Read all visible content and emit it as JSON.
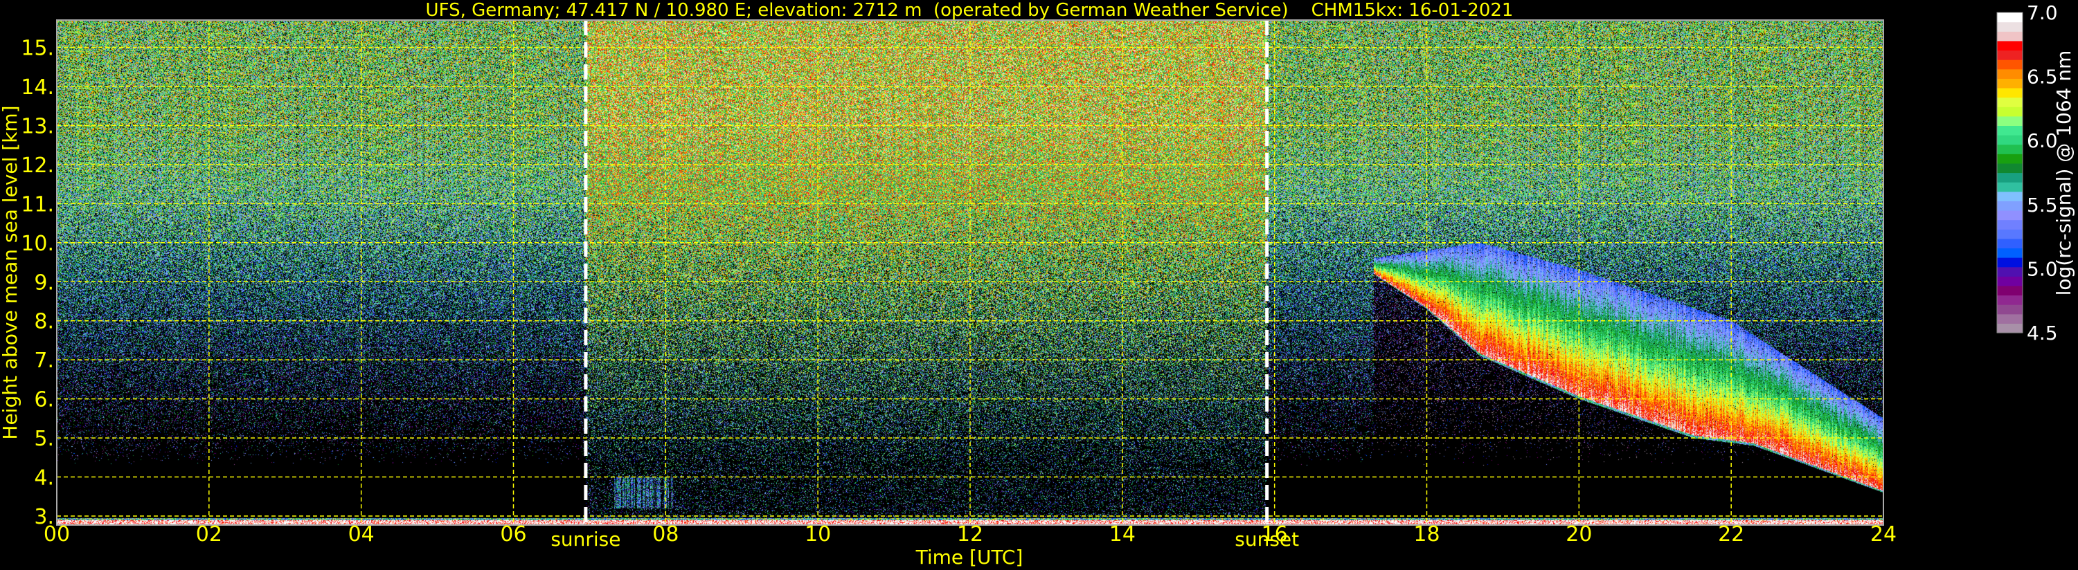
{
  "chart_data": {
    "type": "heatmap",
    "title": "UFS, Germany; 47.417 N / 10.980 E; elevation: 2712 m  (operated by German Weather Service)    CHM15kx: 16-01-2021",
    "xlabel": "Time [UTC]",
    "ylabel": "Height above mean sea level [km]",
    "xlim": [
      0,
      24
    ],
    "ylim": [
      2.77,
      15.7
    ],
    "x_ticks": [
      0,
      2,
      4,
      6,
      8,
      10,
      12,
      14,
      16,
      18,
      20,
      22,
      24
    ],
    "x_tick_labels": [
      "00",
      "02",
      "04",
      "06",
      "08",
      "10",
      "12",
      "14",
      "16",
      "18",
      "20",
      "22",
      "24"
    ],
    "y_ticks": [
      3,
      4,
      5,
      6,
      7,
      8,
      9,
      10,
      11,
      12,
      13,
      14,
      15
    ],
    "y_tick_labels": [
      "3.",
      "4.",
      "5.",
      "6.",
      "7.",
      "8.",
      "9.",
      "10.",
      "11.",
      "12.",
      "13.",
      "14.",
      "15."
    ],
    "grid": true,
    "grid_color": "#ffff00",
    "markers": [
      {
        "label": "sunrise",
        "x": 6.95
      },
      {
        "label": "sunset",
        "x": 15.9
      }
    ],
    "colorbar": {
      "label": "log(rc-signal) @ 1064 nm",
      "range": [
        4.5,
        7.0
      ],
      "ticks": [
        4.5,
        5.0,
        5.5,
        6.0,
        6.5,
        7.0
      ],
      "tick_labels": [
        "4.5",
        "5.0",
        "5.5",
        "6.0",
        "6.5",
        "7.0"
      ],
      "colors_low_to_high": [
        "#a890a8",
        "#a070a0",
        "#904890",
        "#902890",
        "#800070",
        "#7000a0",
        "#5010b0",
        "#0010e0",
        "#0060ff",
        "#3060ff",
        "#5878ff",
        "#7080ff",
        "#9090ff",
        "#80a0ff",
        "#80c0ff",
        "#30c0a0",
        "#18a080",
        "#108830",
        "#18a010",
        "#20c050",
        "#30d880",
        "#40e890",
        "#8cff80",
        "#c8ff30",
        "#e0ff40",
        "#ffe600",
        "#ffb000",
        "#ff8c00",
        "#ff5500",
        "#ee2222",
        "#ff0000",
        "#f0c4c6",
        "#ece0e2",
        "#ffffff"
      ]
    },
    "cloud_layer": {
      "time_range_utc": [
        17.2,
        24
      ],
      "base_km": [
        [
          17.3,
          9.2
        ],
        [
          18.0,
          8.3
        ],
        [
          18.7,
          7.1
        ],
        [
          20.0,
          6.0
        ],
        [
          21.5,
          5.0
        ],
        [
          22.3,
          4.8
        ],
        [
          24.0,
          3.6
        ]
      ],
      "top_km": [
        [
          17.3,
          9.6
        ],
        [
          18.7,
          10.0
        ],
        [
          20.0,
          9.3
        ],
        [
          22.0,
          8.0
        ],
        [
          24.0,
          5.5
        ]
      ]
    }
  }
}
